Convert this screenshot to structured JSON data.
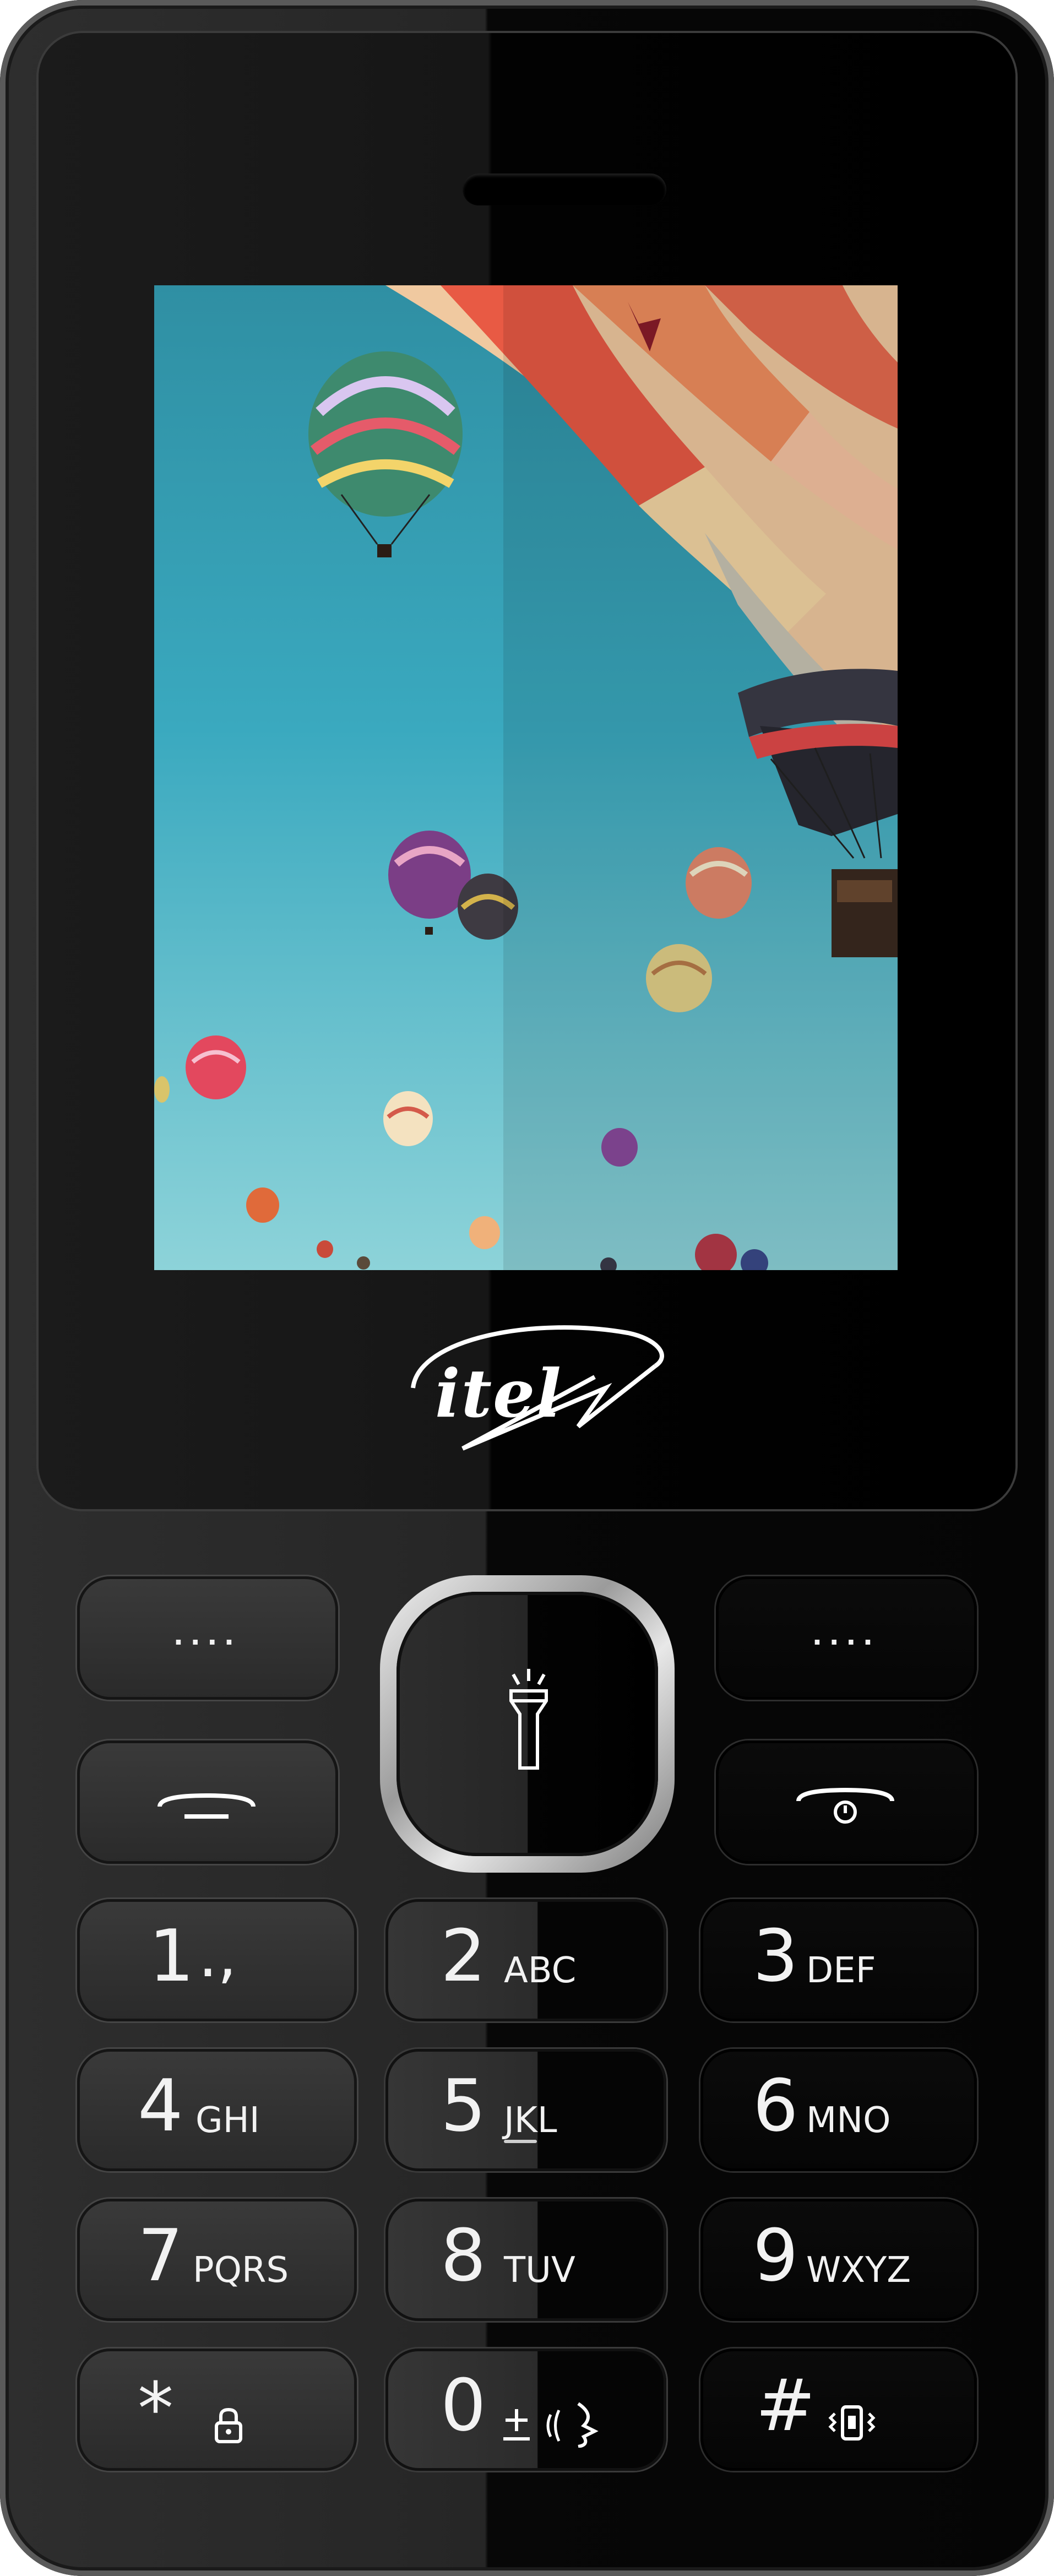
{
  "device": {
    "brand_logo": "itel"
  },
  "soft_keys": {
    "left_top": "....",
    "right_top": "...."
  },
  "center_key": {
    "icon": "flashlight-icon"
  },
  "nav_keys": {
    "call_icon": "call-icon",
    "end_icon": "end-call-power-icon"
  },
  "keypad": [
    {
      "digit": "1",
      "letters": ".,"
    },
    {
      "digit": "2",
      "letters": "ABC"
    },
    {
      "digit": "3",
      "letters": "DEF"
    },
    {
      "digit": "4",
      "letters": "GHI"
    },
    {
      "digit": "5",
      "letters": "JKL"
    },
    {
      "digit": "6",
      "letters": "MNO"
    },
    {
      "digit": "7",
      "letters": "PQRS"
    },
    {
      "digit": "8",
      "letters": "TUV"
    },
    {
      "digit": "9",
      "letters": "WXYZ"
    },
    {
      "digit": "*",
      "letters": "",
      "icon": "lock-icon"
    },
    {
      "digit": "0",
      "letters": "",
      "icon": "plus-voice-icon"
    },
    {
      "digit": "#",
      "letters": "",
      "icon": "vibrate-icon"
    }
  ],
  "colors": {
    "sky": "#3aa9bf",
    "body_dark": "#050505",
    "body_light": "#2a2a2a",
    "ring": "#cfcfcf"
  }
}
